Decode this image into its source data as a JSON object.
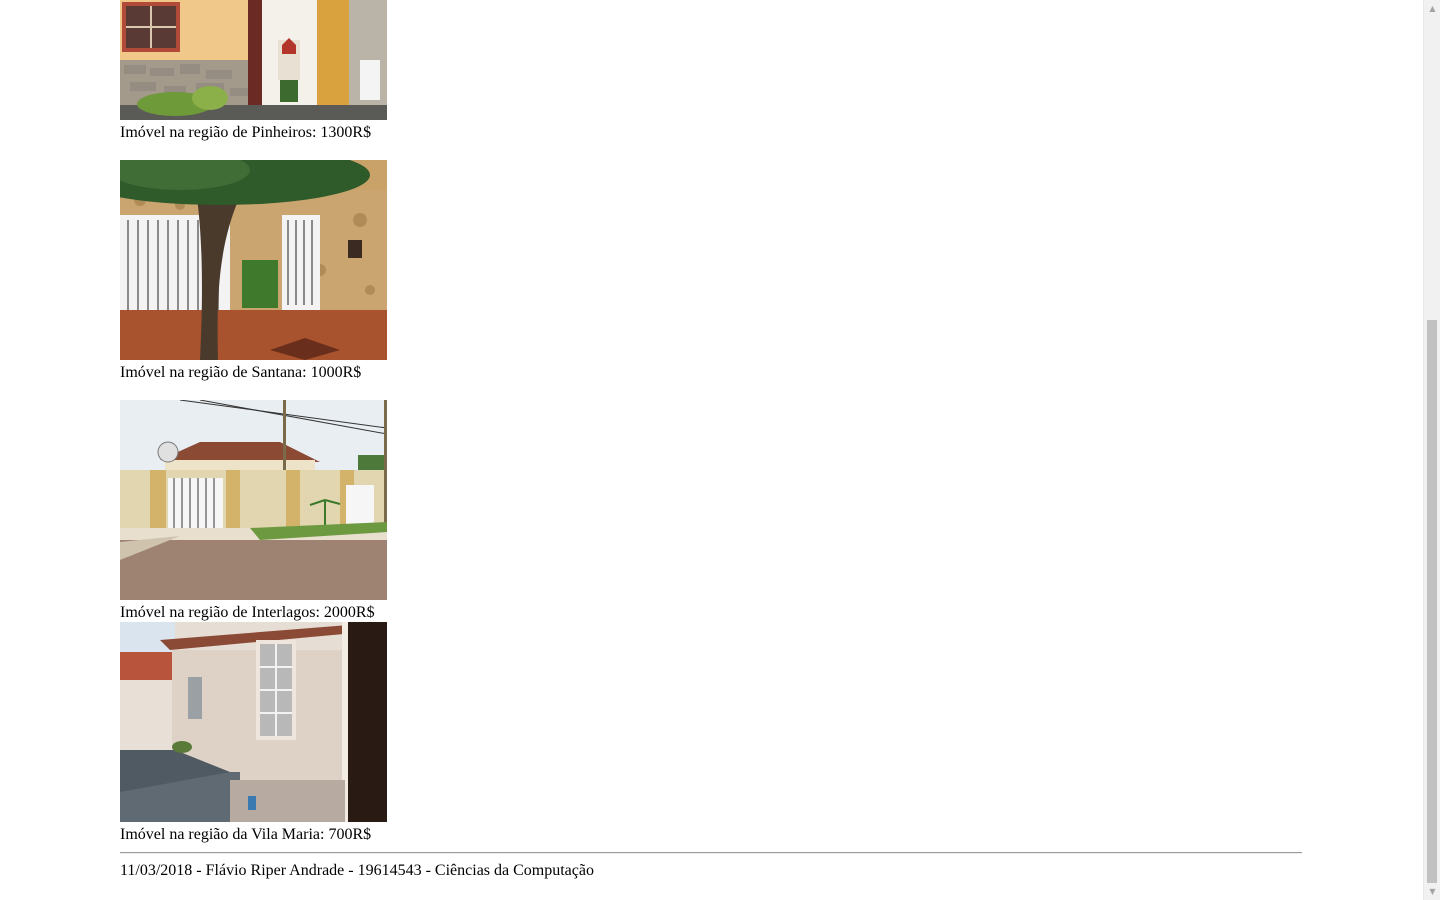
{
  "listings": [
    {
      "caption": "Imóvel na região de Pinheiros: 1300R$",
      "photo_icon": "house-photo-pinheiros"
    },
    {
      "caption": "Imóvel na região de Santana: 1000R$",
      "photo_icon": "house-photo-santana"
    },
    {
      "caption": "Imóvel na região de Interlagos: 2000R$",
      "photo_icon": "house-photo-interlagos"
    },
    {
      "caption": "Imóvel na região da Vila Maria: 700R$",
      "photo_icon": "house-photo-vila-maria"
    }
  ],
  "footer": {
    "text": "11/03/2018 - Flávio Riper Andrade - 19614543 - Ciências da Computação"
  },
  "colors": {
    "scrollbar_track": "#f1f1f1",
    "scrollbar_thumb": "#c1c1c1"
  }
}
